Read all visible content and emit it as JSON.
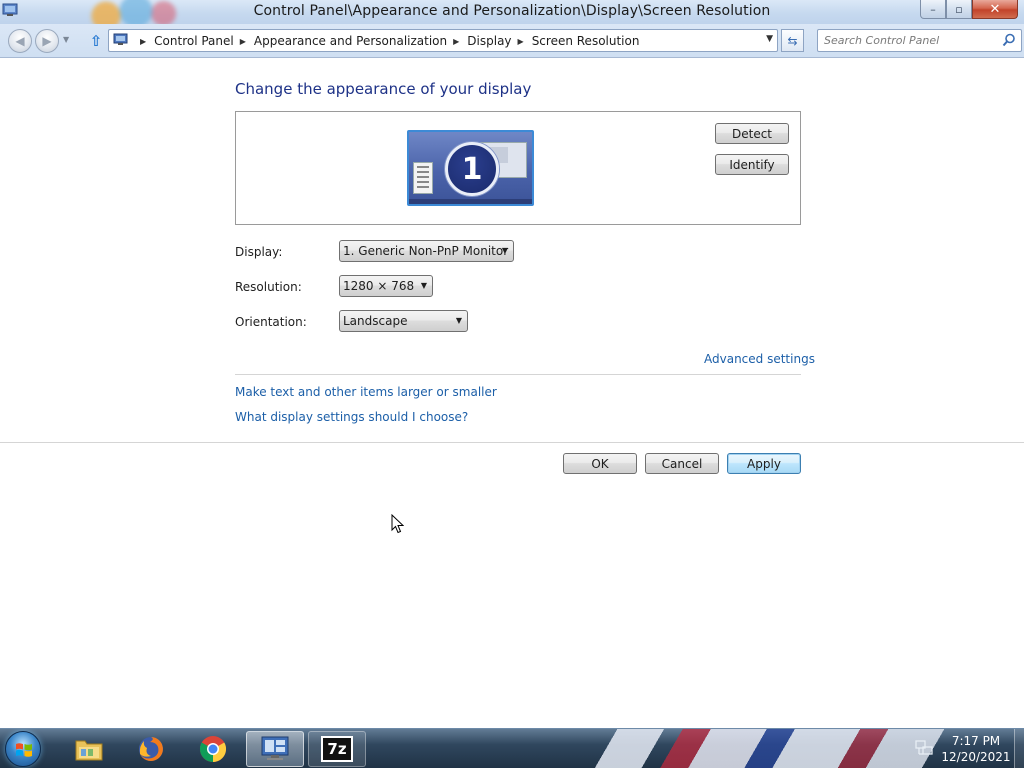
{
  "window": {
    "title": "Control Panel\\Appearance and Personalization\\Display\\Screen Resolution",
    "buttons": {
      "minimize": "–",
      "maximize": "▫",
      "close": "✕"
    }
  },
  "navigation": {
    "back_icon": "back-arrow-icon",
    "forward_icon": "forward-arrow-icon",
    "breadcrumbs": [
      "Control Panel",
      "Appearance and Personalization",
      "Display",
      "Screen Resolution"
    ],
    "search_placeholder": "Search Control Panel"
  },
  "main": {
    "heading": "Change the appearance of your display",
    "monitor_number": "1",
    "detect_label": "Detect",
    "identify_label": "Identify",
    "display_label": "Display:",
    "display_value": "1. Generic Non-PnP Monitor",
    "resolution_label": "Resolution:",
    "resolution_value": "1280 × 768",
    "orientation_label": "Orientation:",
    "orientation_value": "Landscape",
    "advanced_link": "Advanced settings",
    "text_size_link": "Make text and other items larger or smaller",
    "help_link": "What display settings should I choose?",
    "ok_label": "OK",
    "cancel_label": "Cancel",
    "apply_label": "Apply"
  },
  "taskbar": {
    "pinned": [
      "start-orb",
      "file-explorer-icon",
      "firefox-icon",
      "chrome-icon",
      "control-panel-icon",
      "7zip-icon"
    ],
    "sevenzip_text": "7z",
    "time": "7:17 PM",
    "date": "12/20/2021"
  },
  "colors": {
    "heading": "#1e3287",
    "link": "#1c5fa8",
    "titlebar": "#c6d9ef",
    "taskbar": "#1e3a55"
  }
}
